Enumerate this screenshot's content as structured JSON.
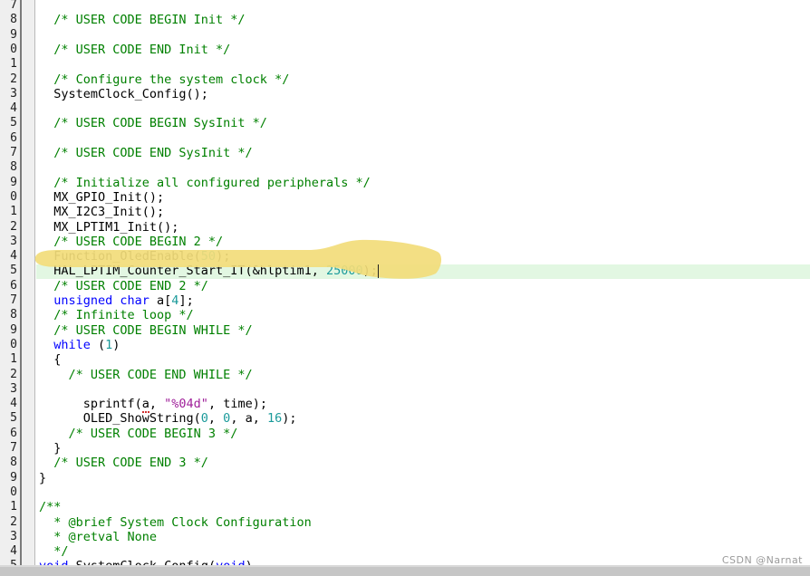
{
  "editor": {
    "language": "c",
    "file_kind": "STM32 HAL main.c",
    "first_visible_line_digit": "7",
    "line_height_px": 16.3,
    "colors": {
      "background": "#ffffff",
      "gutter_background": "#efefef",
      "gutter_text": "#202020",
      "comment": "#008000",
      "keyword": "#0000ff",
      "number": "#1a9a9a",
      "string": "#a0209a",
      "plain": "#000000",
      "current_line_highlight": "#e2f7e2",
      "marker_yellow": "#f2dc7a",
      "error_squiggle": "#d03030",
      "bottom_bar": "#c6c6c6",
      "watermark": "#9a9a9a"
    }
  },
  "gutter": {
    "note": "line numbers are clipped at the left edge; only the final digit of each number is visible",
    "digits": [
      "7",
      "8",
      "9",
      "0",
      "1",
      "2",
      "3",
      "4",
      "5",
      "6",
      "7",
      "8",
      "9",
      "0",
      "1",
      "2",
      "3",
      "4",
      "5",
      "6",
      "7",
      "8",
      "9",
      "0",
      "1",
      "2",
      "3",
      "4",
      "5",
      "6",
      "7",
      "8",
      "9",
      "0",
      "1",
      "2",
      "3",
      "4",
      "5"
    ]
  },
  "lines": [
    {
      "i": 0,
      "indent": 0,
      "tokens": []
    },
    {
      "i": 1,
      "indent": 0,
      "tokens": [
        {
          "t": "cmt",
          "v": "/* USER CODE BEGIN Init */"
        }
      ]
    },
    {
      "i": 2,
      "indent": 0,
      "tokens": []
    },
    {
      "i": 3,
      "indent": 0,
      "tokens": [
        {
          "t": "cmt",
          "v": "/* USER CODE END Init */"
        }
      ]
    },
    {
      "i": 4,
      "indent": 0,
      "tokens": []
    },
    {
      "i": 5,
      "indent": 0,
      "tokens": [
        {
          "t": "cmt",
          "v": "/* Configure the system clock */"
        }
      ]
    },
    {
      "i": 6,
      "indent": 0,
      "tokens": [
        {
          "t": "pl",
          "v": "SystemClock_Config();"
        }
      ]
    },
    {
      "i": 7,
      "indent": 0,
      "tokens": []
    },
    {
      "i": 8,
      "indent": 0,
      "tokens": [
        {
          "t": "cmt",
          "v": "/* USER CODE BEGIN SysInit */"
        }
      ]
    },
    {
      "i": 9,
      "indent": 0,
      "tokens": []
    },
    {
      "i": 10,
      "indent": 0,
      "tokens": [
        {
          "t": "cmt",
          "v": "/* USER CODE END SysInit */"
        }
      ]
    },
    {
      "i": 11,
      "indent": 0,
      "tokens": []
    },
    {
      "i": 12,
      "indent": 0,
      "tokens": [
        {
          "t": "cmt",
          "v": "/* Initialize all configured peripherals */"
        }
      ]
    },
    {
      "i": 13,
      "indent": 0,
      "tokens": [
        {
          "t": "pl",
          "v": "MX_GPIO_Init();"
        }
      ]
    },
    {
      "i": 14,
      "indent": 0,
      "tokens": [
        {
          "t": "pl",
          "v": "MX_I2C3_Init();"
        }
      ]
    },
    {
      "i": 15,
      "indent": 0,
      "tokens": [
        {
          "t": "pl",
          "v": "MX_LPTIM1_Init();"
        }
      ]
    },
    {
      "i": 16,
      "indent": 0,
      "tokens": [
        {
          "t": "cmt",
          "v": "/* USER CODE BEGIN 2 */"
        }
      ]
    },
    {
      "i": 17,
      "indent": 0,
      "tokens": [
        {
          "t": "pl",
          "v": "Function_OledEnable("
        },
        {
          "t": "num",
          "v": "50"
        },
        {
          "t": "pl",
          "v": ");"
        }
      ]
    },
    {
      "i": 18,
      "indent": 0,
      "tokens": [
        {
          "t": "pl",
          "v": "HAL_LPTIM_Counter_Start_IT(&hlptim1, "
        },
        {
          "t": "num",
          "v": "25000"
        },
        {
          "t": "pl",
          "v": ");"
        }
      ]
    },
    {
      "i": 19,
      "indent": 0,
      "tokens": [
        {
          "t": "cmt",
          "v": "/* USER CODE END 2 */"
        }
      ]
    },
    {
      "i": 20,
      "indent": 0,
      "tokens": [
        {
          "t": "kw",
          "v": "unsigned char"
        },
        {
          "t": "pl",
          "v": " a["
        },
        {
          "t": "num",
          "v": "4"
        },
        {
          "t": "pl",
          "v": "];"
        }
      ]
    },
    {
      "i": 21,
      "indent": 0,
      "tokens": [
        {
          "t": "cmt",
          "v": "/* Infinite loop */"
        }
      ]
    },
    {
      "i": 22,
      "indent": 0,
      "tokens": [
        {
          "t": "cmt",
          "v": "/* USER CODE BEGIN WHILE */"
        }
      ]
    },
    {
      "i": 23,
      "indent": 0,
      "tokens": [
        {
          "t": "kw",
          "v": "while"
        },
        {
          "t": "pl",
          "v": " ("
        },
        {
          "t": "num",
          "v": "1"
        },
        {
          "t": "pl",
          "v": ")"
        }
      ]
    },
    {
      "i": 24,
      "indent": 0,
      "tokens": [
        {
          "t": "pl",
          "v": "{"
        }
      ]
    },
    {
      "i": 25,
      "indent": 1,
      "tokens": [
        {
          "t": "cmt",
          "v": "/* USER CODE END WHILE */"
        }
      ]
    },
    {
      "i": 26,
      "indent": 0,
      "tokens": []
    },
    {
      "i": 27,
      "indent": 2,
      "tokens": [
        {
          "t": "pl",
          "v": "sprintf("
        },
        {
          "t": "squig",
          "v": "a"
        },
        {
          "t": "pl",
          "v": ", "
        },
        {
          "t": "str",
          "v": "\"%04d\""
        },
        {
          "t": "pl",
          "v": ", time);"
        }
      ]
    },
    {
      "i": 28,
      "indent": 2,
      "tokens": [
        {
          "t": "pl",
          "v": "OLED_ShowString("
        },
        {
          "t": "num",
          "v": "0"
        },
        {
          "t": "pl",
          "v": ", "
        },
        {
          "t": "num",
          "v": "0"
        },
        {
          "t": "pl",
          "v": ", a, "
        },
        {
          "t": "num",
          "v": "16"
        },
        {
          "t": "pl",
          "v": ");"
        }
      ]
    },
    {
      "i": 29,
      "indent": 1,
      "tokens": [
        {
          "t": "cmt",
          "v": "/* USER CODE BEGIN 3 */"
        }
      ]
    },
    {
      "i": 30,
      "indent": 0,
      "tokens": [
        {
          "t": "pl",
          "v": "}"
        }
      ]
    },
    {
      "i": 31,
      "indent": 0,
      "tokens": [
        {
          "t": "cmt",
          "v": "/* USER CODE END 3 */"
        }
      ]
    },
    {
      "i": 32,
      "indent": -1,
      "tokens": [
        {
          "t": "pl",
          "v": "}"
        }
      ]
    },
    {
      "i": 33,
      "indent": -1,
      "tokens": []
    },
    {
      "i": 34,
      "indent": -1,
      "tokens": [
        {
          "t": "cmt",
          "v": "/**"
        }
      ]
    },
    {
      "i": 35,
      "indent": 0,
      "tokens": [
        {
          "t": "cmt",
          "v": "* @brief System Clock Configuration"
        }
      ]
    },
    {
      "i": 36,
      "indent": 0,
      "tokens": [
        {
          "t": "cmt",
          "v": "* @retval None"
        }
      ]
    },
    {
      "i": 37,
      "indent": 0,
      "tokens": [
        {
          "t": "cmt",
          "v": "*/"
        }
      ]
    },
    {
      "i": 38,
      "indent": -1,
      "tokens": [
        {
          "t": "kw",
          "v": "void"
        },
        {
          "t": "pl",
          "v": " SystemClock_Config("
        },
        {
          "t": "kw",
          "v": "void"
        },
        {
          "t": "pl",
          "v": ")"
        }
      ]
    }
  ],
  "annotations": {
    "highlighted_line_index": 18,
    "highlighted_line_text": "HAL_LPTIM_Counter_Start_IT(&hlptim1, 25000);",
    "marker_shape": "hand-drawn yellow highlighter brush stroke",
    "caret_after": ";"
  },
  "watermark": {
    "text": "CSDN @Narnat"
  }
}
